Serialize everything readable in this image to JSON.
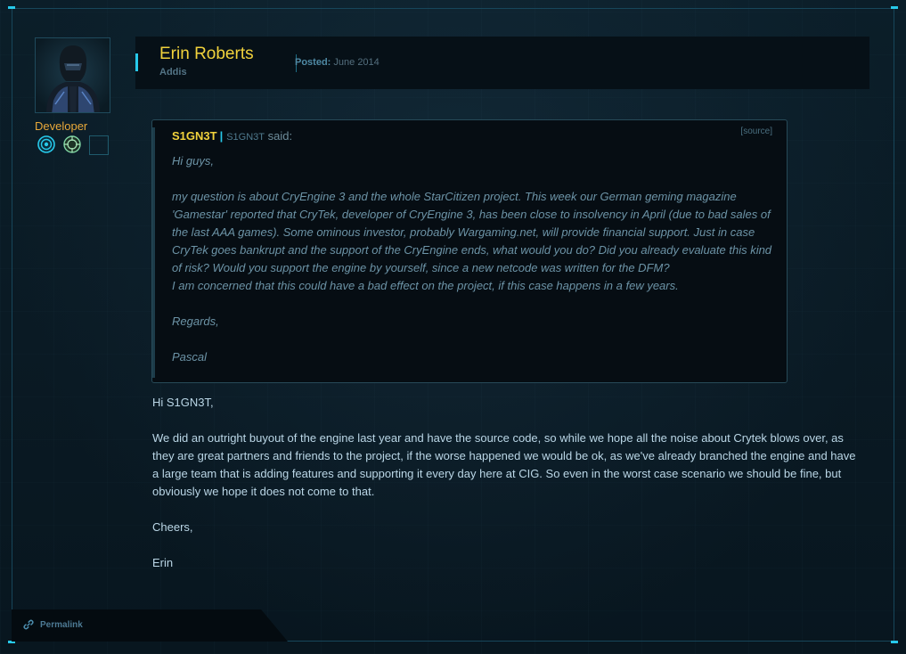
{
  "author": {
    "name": "Erin Roberts",
    "subtitle": "Addis",
    "role": "Developer"
  },
  "post": {
    "posted_label": "Posted:",
    "posted_date": "June 2014"
  },
  "quote": {
    "user": "S1GN3T",
    "user_sub": "S1GN3T",
    "said": "said:",
    "source_label": "[source]",
    "greeting": "Hi guys,",
    "body_1": "my question is about CryEngine 3 and the whole StarCitizen project. This week our German geming magazine 'Gamestar' reported that CryTek, developer of CryEngine 3, has been close to insolvency in April (due to bad sales of the last AAA games). Some ominous investor, probably Wargaming.net, will provide financial support. Just in case CryTek goes bankrupt and the support of the CryEngine ends, what would you do? Did you already evaluate this kind of risk? Would you support the engine by yourself, since a new netcode was written for the DFM?",
    "body_2": "I am concerned that this could have a bad effect on the project, if this case happens in a few years.",
    "regards": "Regards,",
    "signoff": "Pascal"
  },
  "reply": {
    "greeting": "Hi S1GN3T,",
    "body": "We did an outright buyout of the engine last year and have the source code, so while we hope all the noise about Crytek blows over, as they are great partners and friends to the project, if the worse happened we would be ok, as we've already branched the engine and have a large team that is adding features and supporting it every day here at CIG. So even in the worst case scenario we should be fine, but obviously we hope it does not come to that.",
    "cheers": "Cheers,",
    "signoff": "Erin"
  },
  "footer": {
    "permalink_label": "Permalink"
  },
  "colors": {
    "accent": "#27c9ea",
    "author_name": "#f1d23c",
    "role": "#e8a83a",
    "reply_text": "#bad6e6",
    "quote_text": "#6c93a6"
  },
  "icons": {
    "badge_1": "target-badge-icon",
    "badge_2": "crosshair-badge-icon",
    "badge_3": "empty-badge-slot",
    "permalink": "link-icon"
  }
}
